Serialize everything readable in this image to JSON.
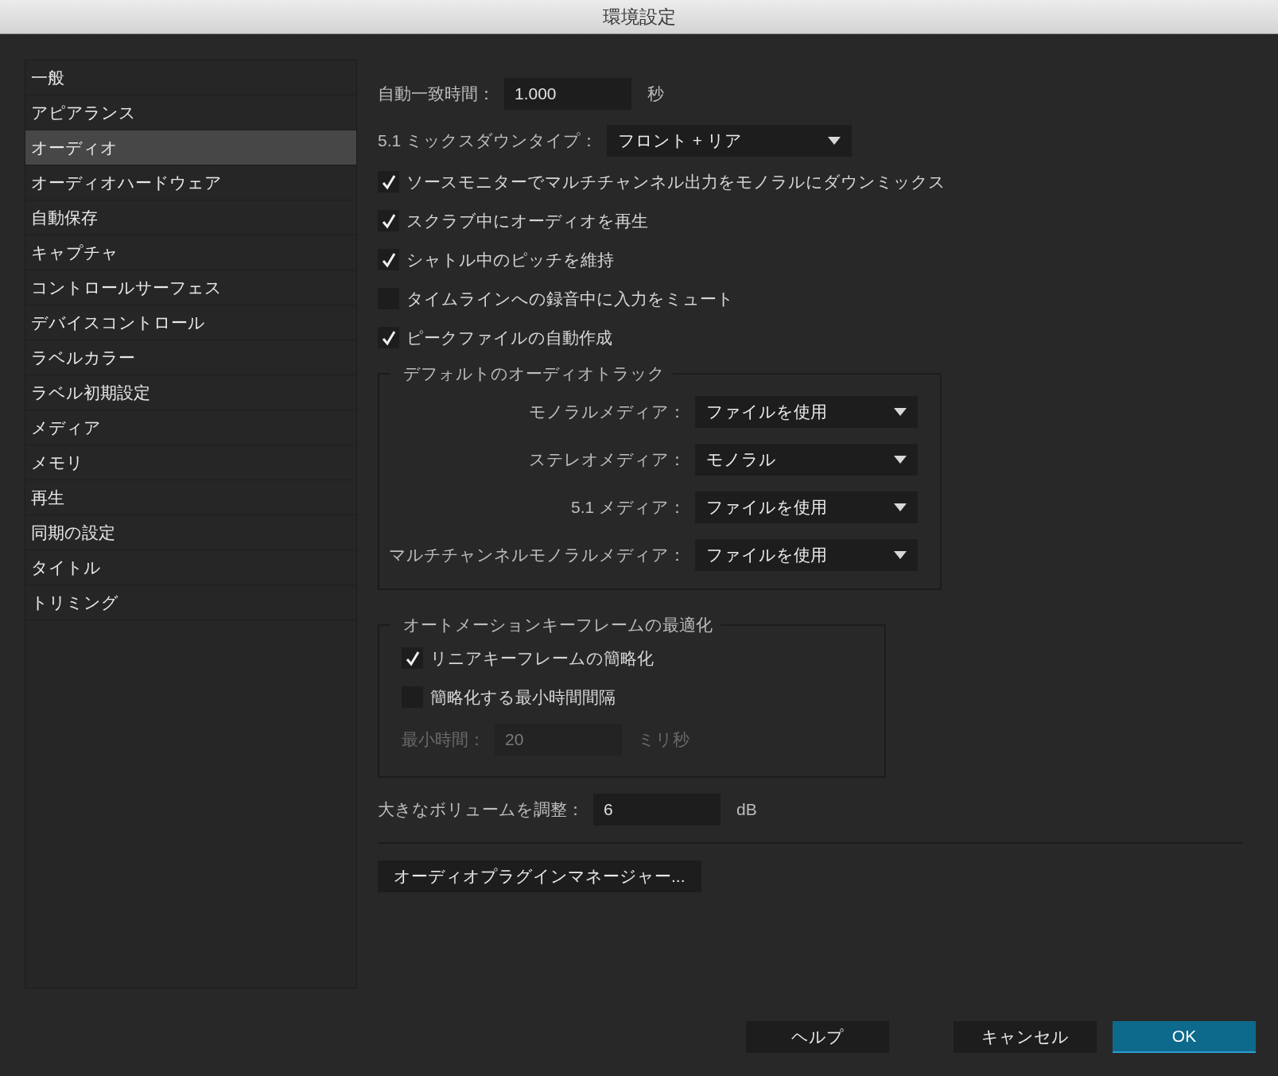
{
  "window": {
    "title": "環境設定"
  },
  "sidebar": {
    "items": [
      {
        "label": "一般",
        "selected": false
      },
      {
        "label": "アピアランス",
        "selected": false
      },
      {
        "label": "オーディオ",
        "selected": true
      },
      {
        "label": "オーディオハードウェア",
        "selected": false
      },
      {
        "label": "自動保存",
        "selected": false
      },
      {
        "label": "キャプチャ",
        "selected": false
      },
      {
        "label": "コントロールサーフェス",
        "selected": false
      },
      {
        "label": "デバイスコントロール",
        "selected": false
      },
      {
        "label": "ラベルカラー",
        "selected": false
      },
      {
        "label": "ラベル初期設定",
        "selected": false
      },
      {
        "label": "メディア",
        "selected": false
      },
      {
        "label": "メモリ",
        "selected": false
      },
      {
        "label": "再生",
        "selected": false
      },
      {
        "label": "同期の設定",
        "selected": false
      },
      {
        "label": "タイトル",
        "selected": false
      },
      {
        "label": "トリミング",
        "selected": false
      }
    ]
  },
  "settings": {
    "auto_match_time": {
      "label": "自動一致時間：",
      "value": "1.000",
      "unit": "秒"
    },
    "mixdown_type": {
      "label": "5.1 ミックスダウンタイプ：",
      "value": "フロント + リア"
    },
    "checkboxes": [
      {
        "label": "ソースモニターでマルチチャンネル出力をモノラルにダウンミックス",
        "checked": true
      },
      {
        "label": "スクラブ中にオーディオを再生",
        "checked": true
      },
      {
        "label": "シャトル中のピッチを維持",
        "checked": true
      },
      {
        "label": "タイムラインへの録音中に入力をミュート",
        "checked": false
      },
      {
        "label": "ピークファイルの自動作成",
        "checked": true
      }
    ],
    "default_tracks": {
      "title": "デフォルトのオーディオトラック",
      "rows": [
        {
          "label": "モノラルメディア：",
          "value": "ファイルを使用"
        },
        {
          "label": "ステレオメディア：",
          "value": "モノラル"
        },
        {
          "label": "5.1 メディア：",
          "value": "ファイルを使用"
        },
        {
          "label": "マルチチャンネルモノラルメディア：",
          "value": "ファイルを使用"
        }
      ]
    },
    "automation": {
      "title": "オートメーションキーフレームの最適化",
      "checkboxes": [
        {
          "label": "リニアキーフレームの簡略化",
          "checked": true
        },
        {
          "label": "簡略化する最小時間間隔",
          "checked": false
        }
      ],
      "min_time": {
        "label": "最小時間：",
        "value": "20",
        "unit": "ミリ秒",
        "disabled": true
      }
    },
    "volume": {
      "label": "大きなボリュームを調整：",
      "value": "6",
      "unit": "dB"
    },
    "plugin_button": "オーディオプラグインマネージャー..."
  },
  "buttons": [
    {
      "label": "ヘルプ",
      "kind": "default"
    },
    {
      "label": "キャンセル",
      "kind": "default"
    },
    {
      "label": "OK",
      "kind": "primary"
    }
  ]
}
